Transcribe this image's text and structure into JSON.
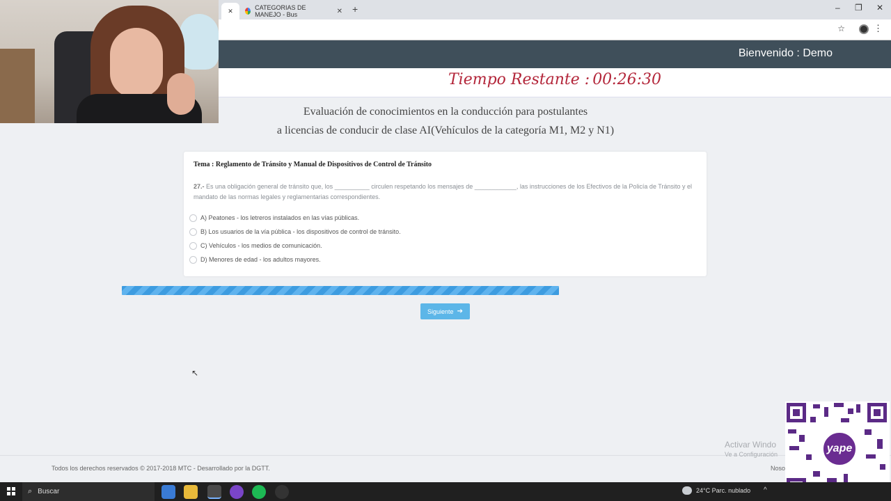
{
  "browser": {
    "tabs": [
      {
        "label": ""
      },
      {
        "label": "CATEGORIAS DE MANEJO - Bus"
      }
    ],
    "new_tab": "+",
    "window_controls": {
      "minimize": "–",
      "restore": "❐",
      "close": "✕"
    }
  },
  "header": {
    "welcome": "Bienvenido : Demo",
    "timer_label": "Tiempo Restante :",
    "timer_value": "00:26:30"
  },
  "exam": {
    "title_line1": "Evaluación de conocimientos en la conducción para postulantes",
    "title_line2": "a licencias de conducir de clase AI(Vehículos de la categoría M1, M2 y N1)",
    "topic": "Tema : Reglamento de Tránsito y Manual de Dispositivos de Control de Tránsito",
    "question_number": "27.-",
    "question_text": " Es una obligación general de tránsito que, los __________ circulen respetando los mensajes de ____________, las instrucciones de los Efectivos de la Policía de Tránsito y el mandato de las normas legales y reglamentarias correspondientes.",
    "options": [
      "A) Peatones - los letreros instalados en las vías públicas.",
      "B) Los usuarios de la vía pública - los dispositivos de control de tránsito.",
      "C) Vehículos - los medios de comunicación.",
      "D) Menores de edad - los adultos mayores."
    ],
    "progress_fraction": 0.74,
    "next_label": "Siguiente"
  },
  "footer": {
    "copyright": "Todos los derechos reservados © 2017-2018 MTC - Desarrollado por la DGTT.",
    "right_text": "Noso",
    "activate_title": "Activar Windo",
    "activate_sub": "Ve a Configuración"
  },
  "overlay": {
    "qr_badge": "yape"
  },
  "taskbar": {
    "search_label": "Buscar",
    "weather": "24°C  Parc. nublado",
    "tray": "^"
  },
  "colors": {
    "topbar": "#3f4f5a",
    "timer": "#b3263a",
    "accent": "#5cb6e8",
    "progress": "#3d9ce0"
  }
}
